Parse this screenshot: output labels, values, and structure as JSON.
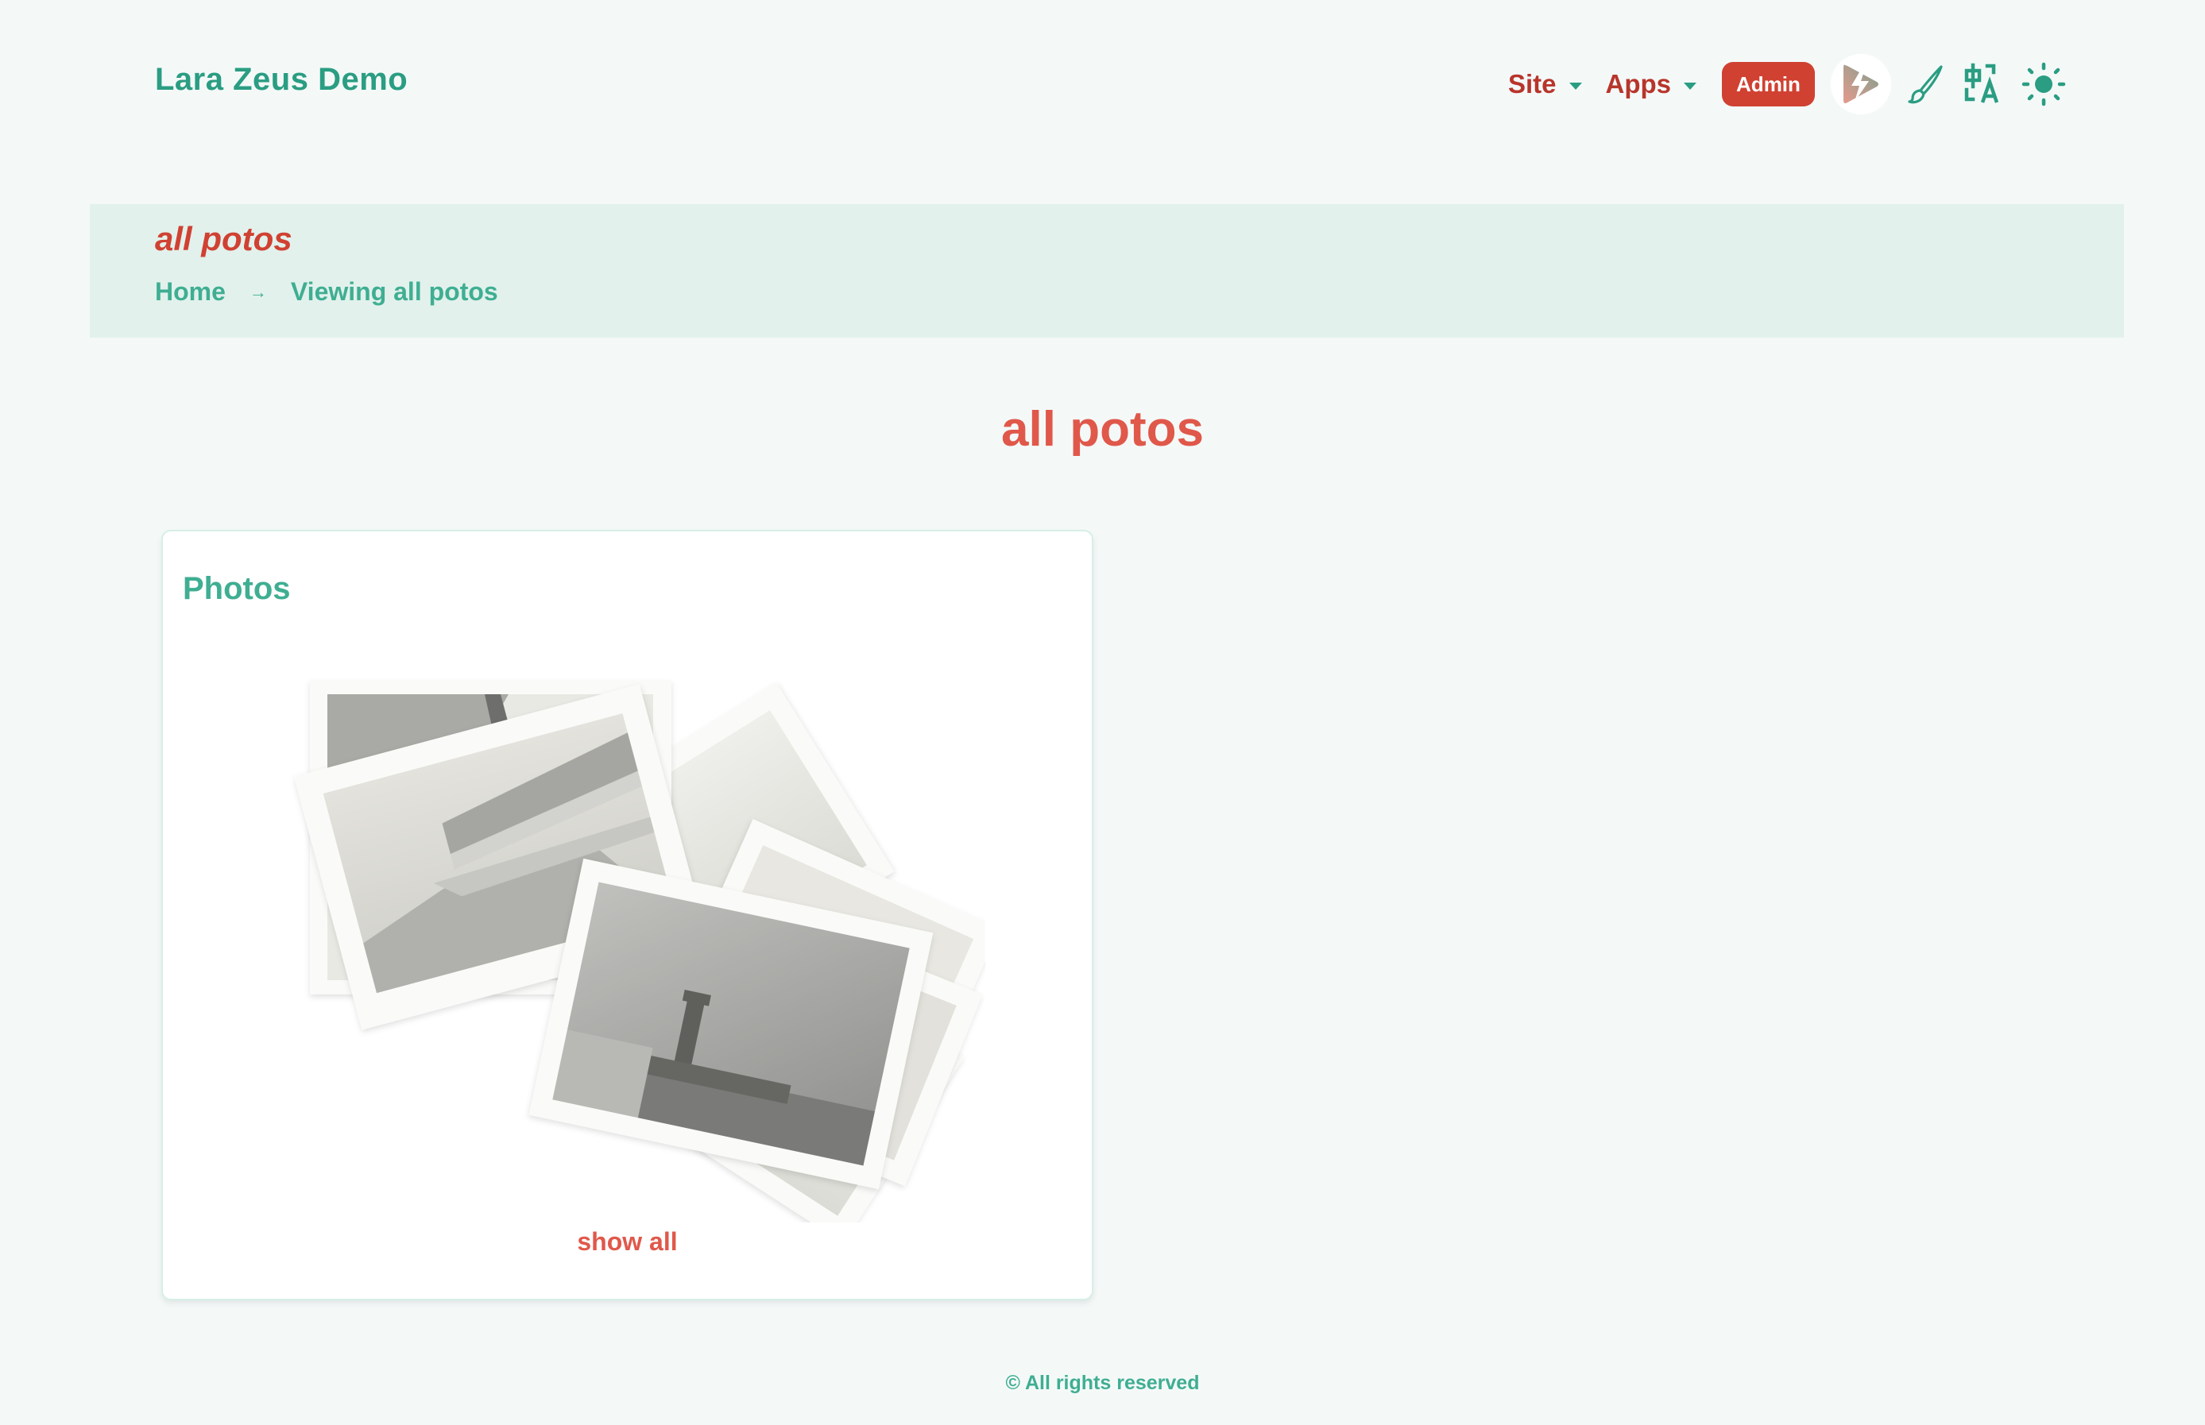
{
  "header": {
    "logo": "Lara Zeus Demo",
    "nav": [
      {
        "label": "Site",
        "icon": "caret-down-icon"
      },
      {
        "label": "Apps",
        "icon": "caret-down-icon"
      }
    ],
    "admin_label": "Admin",
    "icons": [
      "lightning-play-icon",
      "paintbrush-icon",
      "translate-icon",
      "sun-icon"
    ]
  },
  "hero": {
    "title": "all potos",
    "breadcrumbs": [
      {
        "label": "Home"
      },
      {
        "label": "Viewing all potos"
      }
    ],
    "separator": "→"
  },
  "main": {
    "heading": "all potos",
    "card": {
      "title": "Photos",
      "link_label": "show all"
    }
  },
  "footer": {
    "text": "© All rights reserved"
  },
  "colors": {
    "brand_teal": "#2a9d82",
    "accent_red": "#d04132",
    "heading_red": "#e0584a",
    "hero_bg": "#e2f1ec",
    "page_bg": "#f4f9f8"
  }
}
